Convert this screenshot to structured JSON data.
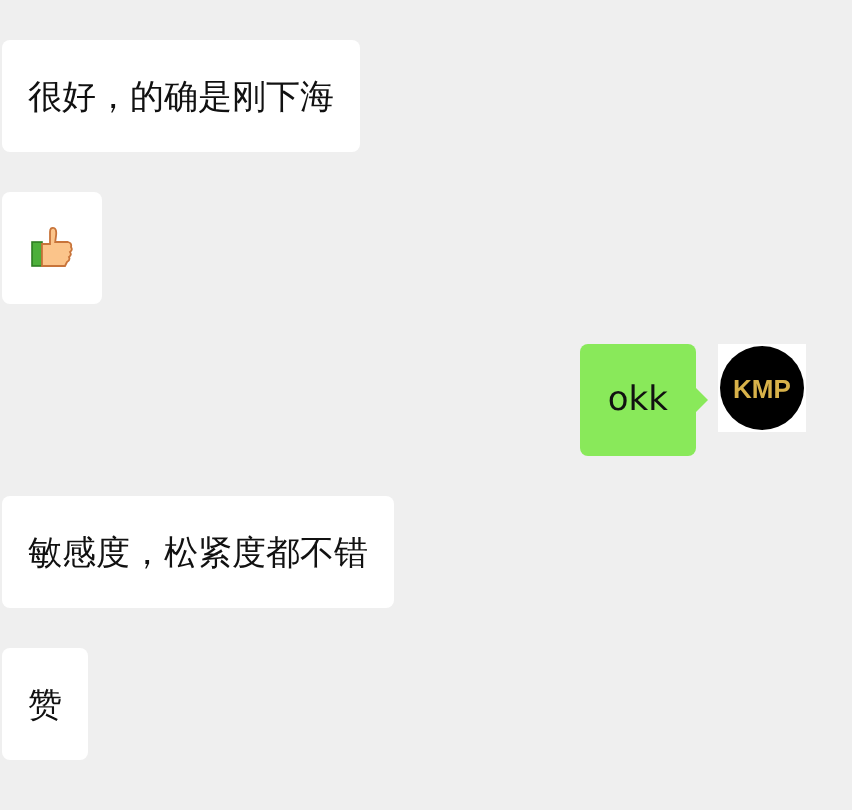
{
  "messages": [
    {
      "kind": "text",
      "outgoing": false,
      "text": "很好，的确是刚下海"
    },
    {
      "kind": "thumbs-up",
      "outgoing": false
    },
    {
      "kind": "text",
      "outgoing": true,
      "text": "okk",
      "avatar": "KMP"
    },
    {
      "kind": "text",
      "outgoing": false,
      "text": "敏感度，松紧度都不错"
    },
    {
      "kind": "text",
      "outgoing": false,
      "text": "赞"
    }
  ]
}
